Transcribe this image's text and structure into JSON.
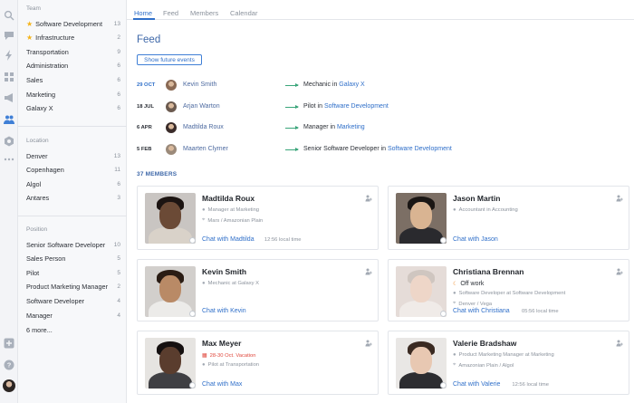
{
  "rail_icons": [
    "search-icon",
    "chat-icon",
    "lightning-icon",
    "apps-icon",
    "megaphone-icon",
    "people-icon",
    "hexagon-icon",
    "more-icon",
    "add-icon",
    "help-icon"
  ],
  "sidebar": {
    "team_title": "Team",
    "team": [
      {
        "label": "Software Development",
        "count": "13",
        "starred": true
      },
      {
        "label": "Infrastructure",
        "count": "2",
        "starred": true
      },
      {
        "label": "Transportation",
        "count": "9"
      },
      {
        "label": "Administration",
        "count": "6"
      },
      {
        "label": "Sales",
        "count": "6"
      },
      {
        "label": "Marketing",
        "count": "6"
      },
      {
        "label": "Galaxy X",
        "count": "6"
      }
    ],
    "location_title": "Location",
    "location": [
      {
        "label": "Denver",
        "count": "13"
      },
      {
        "label": "Copenhagen",
        "count": "11"
      },
      {
        "label": "Algol",
        "count": "6"
      },
      {
        "label": "Antares",
        "count": "3"
      }
    ],
    "position_title": "Position",
    "position": [
      {
        "label": "Senior Software Developer",
        "count": "10"
      },
      {
        "label": "Sales Person",
        "count": "5"
      },
      {
        "label": "Pilot",
        "count": "5"
      },
      {
        "label": "Product Marketing Manager",
        "count": "2"
      },
      {
        "label": "Software Developer",
        "count": "4"
      },
      {
        "label": "Manager",
        "count": "4"
      }
    ],
    "more_label": "6 more..."
  },
  "tabs": [
    "Home",
    "Feed",
    "Members",
    "Calendar"
  ],
  "feed": {
    "title": "Feed",
    "show_future": "Show future events",
    "events": [
      {
        "date": "29 OCT",
        "name": "Kevin Smith",
        "role": "Mechanic in ",
        "link": "Galaxy X"
      },
      {
        "date": "18 JUL",
        "name": "Arjan Warton",
        "role": "Pilot in ",
        "link": "Software Development"
      },
      {
        "date": "6 APR",
        "name": "Madtilda Roux",
        "role": "Manager in ",
        "link": "Marketing"
      },
      {
        "date": "5 FEB",
        "name": "Maarten Clymer",
        "role": "Senior Software Developer in ",
        "link": "Software Development"
      }
    ]
  },
  "members_header": "37 MEMBERS",
  "members": [
    {
      "name": "Madtilda Roux",
      "line1": "Manager at Marketing",
      "line2": "Mars / Amazonian Plain",
      "chat": "Chat with Madtilda",
      "time": "12:56 local time"
    },
    {
      "name": "Jason Martin",
      "line1": "Accountant in Accounting",
      "chat": "Chat with Jason"
    },
    {
      "name": "Kevin Smith",
      "line1": "Mechanic at Galaxy X",
      "chat": "Chat with Kevin"
    },
    {
      "name": "Christiana Brennan",
      "status": "Off work",
      "line1": "Software Developer at Software Development",
      "line2": "Denver / Vega",
      "chat": "Chat with Christiana",
      "time": "05:56 local time"
    },
    {
      "name": "Max Meyer",
      "vacation": "28-30 Oct. Vacation",
      "line1": "Pilot at Transportation",
      "chat": "Chat with Max"
    },
    {
      "name": "Valerie Bradshaw",
      "line1": "Product Marketing Manager at Marketing",
      "line2": "Amazonian Plain / Algol",
      "chat": "Chat with Valerie",
      "time": "12:56 local time"
    }
  ]
}
